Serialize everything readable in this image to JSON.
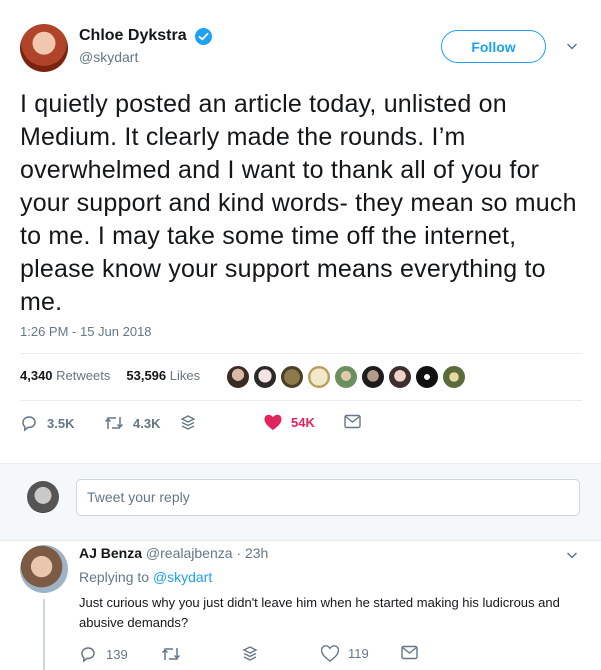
{
  "tweet": {
    "display_name": "Chloe Dykstra",
    "handle": "@skydart",
    "follow_label": "Follow",
    "text": "I quietly posted an article today, unlisted on Medium. It clearly made the rounds. I’m overwhelmed and I want to thank all of you for your support and kind words- they mean so much to me. I may take some time off the internet,  please know your support means everything to me.",
    "timestamp": "1:26 PM - 15 Jun 2018",
    "retweets_count": "4,340",
    "retweets_label": "Retweets",
    "likes_count": "53,596",
    "likes_label": "Likes",
    "actions": {
      "reply_count": "3.5K",
      "retweet_count": "4.3K",
      "like_count": "54K"
    },
    "colors": {
      "accent": "#1da1f2",
      "like": "#e0245e",
      "muted": "#657786"
    }
  },
  "reply_box": {
    "placeholder": "Tweet your reply"
  },
  "reply": {
    "display_name": "AJ Benza",
    "handle": "@realajbenza",
    "time": "· 23h",
    "replying_to_prefix": "Replying to",
    "replying_to_handle": "@skydart",
    "text": "Just curious why you just didn't leave him when he started making his ludicrous and abusive demands?",
    "reply_count": "139",
    "like_count": "119"
  }
}
